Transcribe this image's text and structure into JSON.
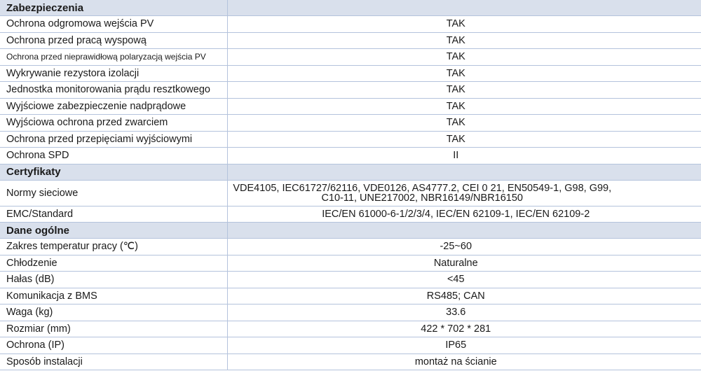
{
  "sections": [
    {
      "title": "Zabezpieczenia",
      "rows": [
        {
          "label": "Ochrona odgromowa wejścia PV",
          "value": "TAK"
        },
        {
          "label": "Ochrona przed pracą wyspową",
          "value": "TAK"
        },
        {
          "label": "Ochrona przed nieprawidłową polaryzacją wejścia PV",
          "value": "TAK"
        },
        {
          "label": "Wykrywanie rezystora izolacji",
          "value": "TAK"
        },
        {
          "label": "Jednostka monitorowania prądu resztkowego",
          "value": "TAK"
        },
        {
          "label": "Wyjściowe zabezpieczenie nadprądowe",
          "value": "TAK"
        },
        {
          "label": "Wyjściowa ochrona przed zwarciem",
          "value": "TAK"
        },
        {
          "label": "Ochrona przed przepięciami wyjściowymi",
          "value": "TAK"
        },
        {
          "label": "Ochrona SPD",
          "value": "II"
        }
      ]
    },
    {
      "title": "Certyfikaty",
      "rows": [
        {
          "label": "Normy sieciowe",
          "value": "VDE4105, IEC61727/62116, VDE0126, AS4777.2, CEI 0 21, EN50549-1, G98, G99, C10-11, UNE217002, NBR16149/NBR16150"
        },
        {
          "label": "EMC/Standard",
          "value": "IEC/EN 61000-6-1/2/3/4, IEC/EN 62109-1, IEC/EN 62109-2"
        }
      ]
    },
    {
      "title": "Dane ogólne",
      "rows": [
        {
          "label": "Zakres temperatur pracy (℃)",
          "value": "-25~60"
        },
        {
          "label": "Chłodzenie",
          "value": "Naturalne"
        },
        {
          "label": "Hałas (dB)",
          "value": "<45"
        },
        {
          "label": "Komunikacja z BMS",
          "value": "RS485; CAN"
        },
        {
          "label": "Waga (kg)",
          "value": "33.6"
        },
        {
          "label": "Rozmiar (mm)",
          "value": "422 * 702 * 281"
        },
        {
          "label": "Ochrona (IP)",
          "value": "IP65"
        },
        {
          "label": "Sposób instalacji",
          "value": "montaż na ścianie"
        }
      ]
    }
  ]
}
